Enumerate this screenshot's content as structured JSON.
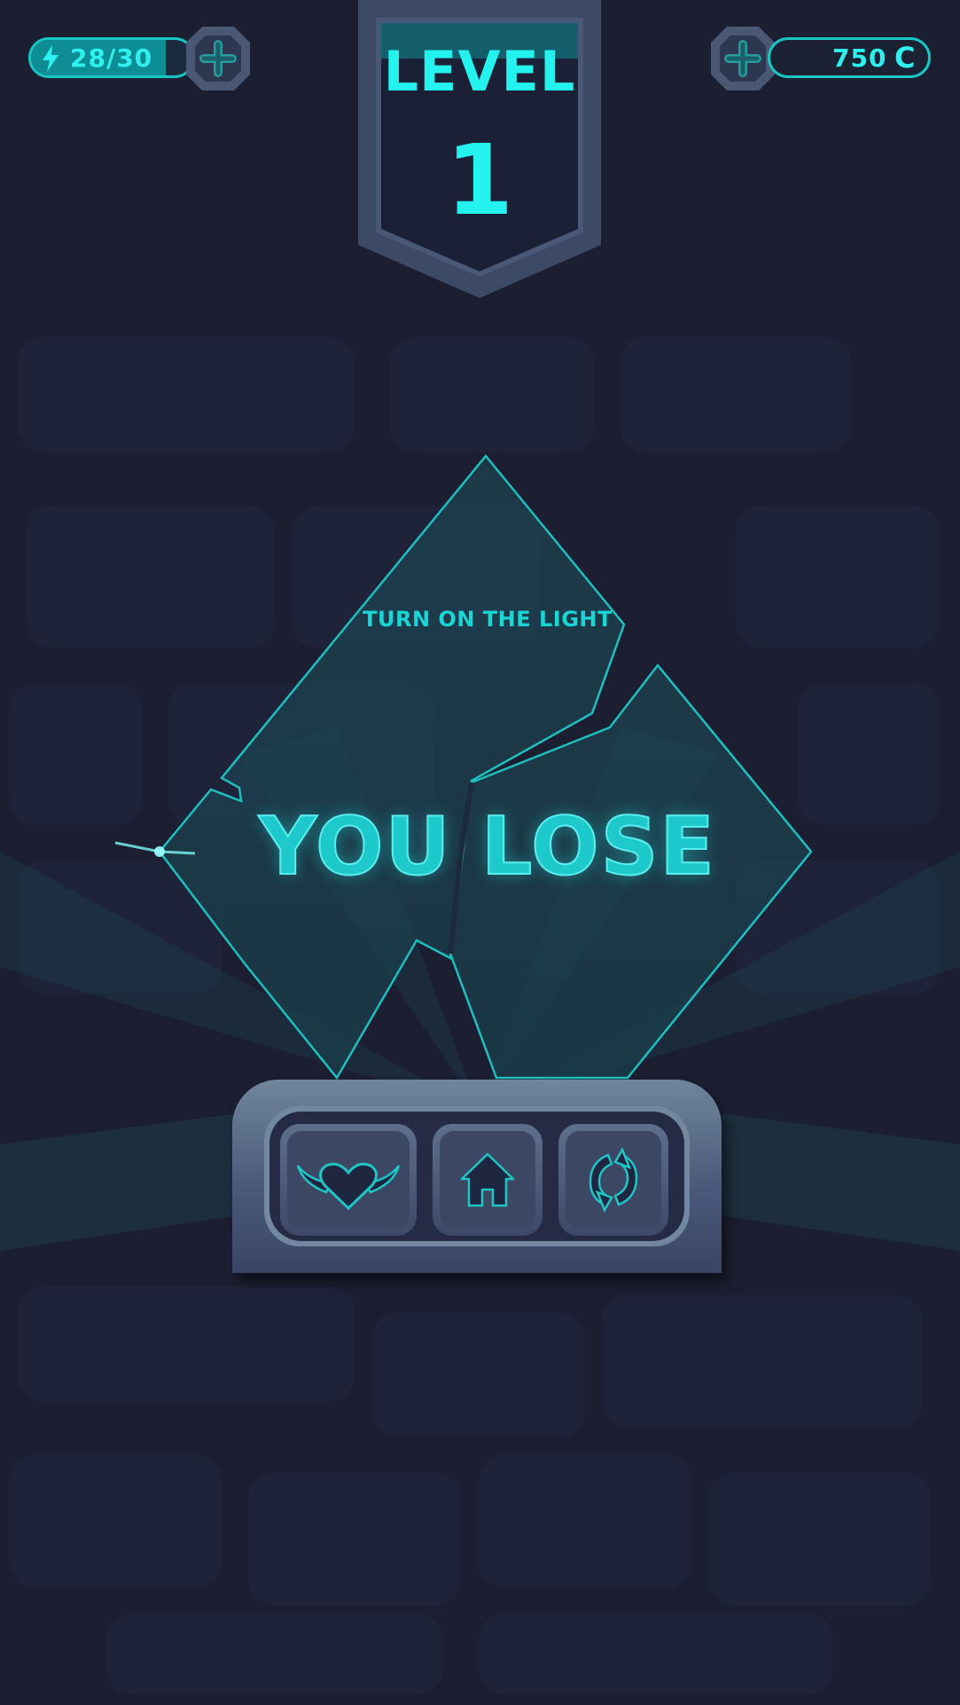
{
  "hud": {
    "energy_text": "28/30",
    "energy_fraction": 0.93,
    "coins_text": "750",
    "coin_symbol": "C"
  },
  "level": {
    "label": "LEVEL",
    "number": "1"
  },
  "result": {
    "subtitle": "TURN ON THE LIGHT",
    "title": "YOU LOSE"
  },
  "icons": {
    "energy": "lightning-icon",
    "add_energy": "plus-icon",
    "add_coins": "plus-icon",
    "revive": "winged-heart-icon",
    "home": "home-icon",
    "retry": "refresh-icon"
  },
  "colors": {
    "accent": "#24f2ee",
    "background": "#1c1f32",
    "panel": "#4a5a7a"
  }
}
